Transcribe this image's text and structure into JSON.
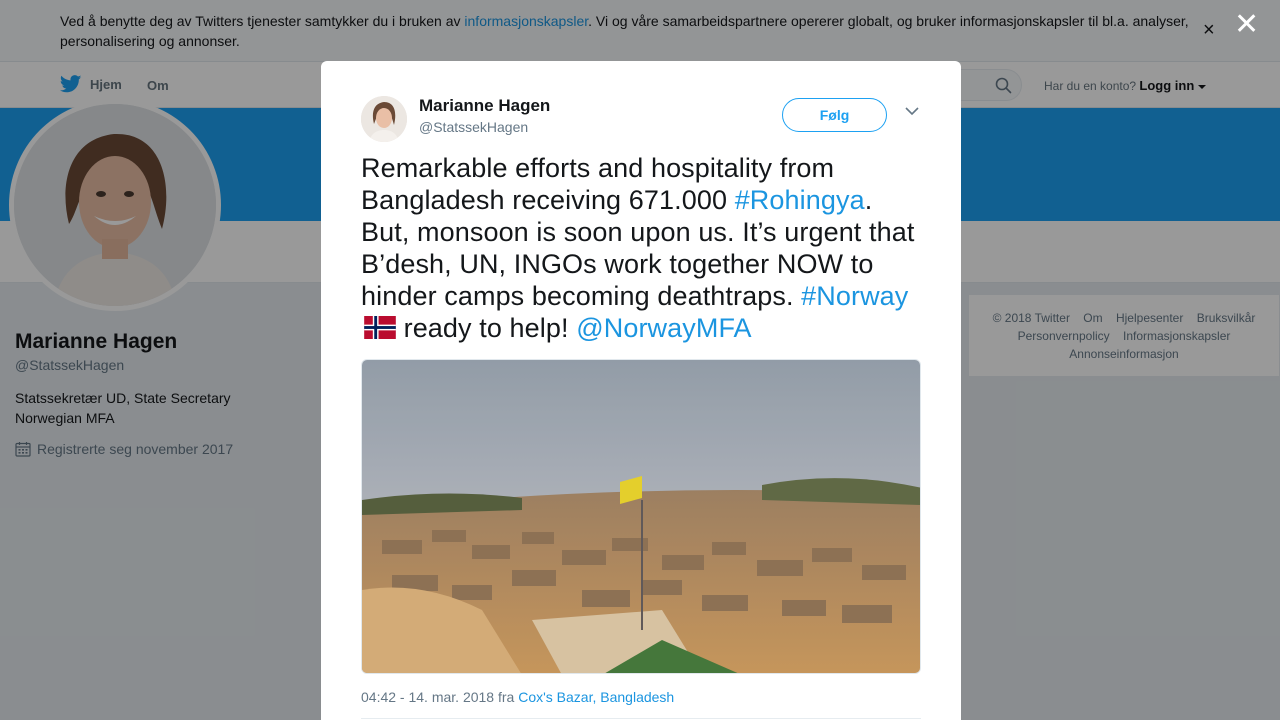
{
  "cookie": {
    "text_before": "Ved å benytte deg av Twitters tjenester samtykker du i bruken av ",
    "link": "informasjonskapsler",
    "text_after": ". Vi og våre samarbeidspartnere opererer globalt, og bruker informasjonskapsler til bl.a. analyser, personalisering og annonser.",
    "close": "×"
  },
  "nav": {
    "home": "Hjem",
    "about": "Om",
    "login_prompt": "Har du en konto?",
    "login_link": "Logg inn"
  },
  "profile": {
    "name": "Marianne Hagen",
    "handle": "@StatssekHagen",
    "bio": "Statssekretær UD, State Secretary Norwegian MFA",
    "joined": "Registrerte seg november 2017"
  },
  "footer": {
    "copyright": "© 2018 Twitter",
    "about": "Om",
    "help": "Hjelpesenter",
    "terms": "Bruksvilkår",
    "privacy": "Personvernpolicy",
    "cookies": "Informasjonskapsler",
    "ads": "Annonseinformasjon"
  },
  "overlay": {
    "close": "✕"
  },
  "tweet": {
    "author_name": "Marianne Hagen",
    "author_handle": "@StatssekHagen",
    "follow_label": "Følg",
    "text_1": "Remarkable efforts and hospitality from Bangladesh receiving 671.000 ",
    "hashtag_1": "#Rohingya",
    "text_2": ". But, monsoon is soon upon us. It’s urgent that B’desh, UN, INGOs work together NOW to hinder camps becoming deathtraps. ",
    "hashtag_2": "#Norway",
    "text_3": " ready to help! ",
    "mention": "@NorwayMFA",
    "timestamp": "04:42 - 14. mar. 2018 fra ",
    "location": "Cox's Bazar, Bangladesh"
  },
  "colors": {
    "accent": "#1da1f2",
    "link": "#1b95e0",
    "muted": "#657786"
  }
}
